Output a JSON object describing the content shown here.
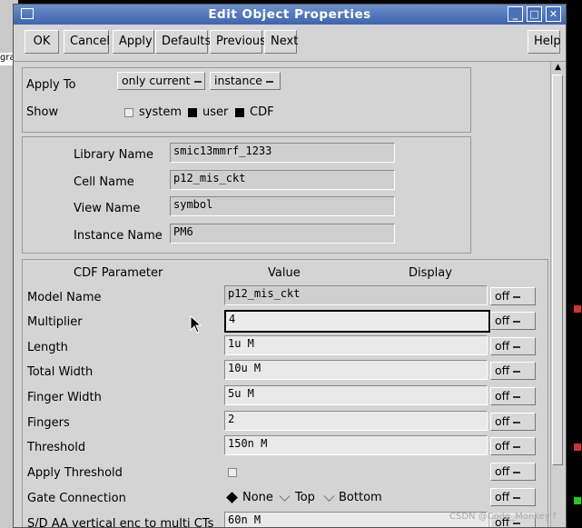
{
  "window": {
    "title": "Edit Object Properties"
  },
  "background": {
    "left_fragment": "gra",
    "watermark": "CSDN @Code_Monkey f"
  },
  "title_buttons": [
    "_",
    "□",
    "✕"
  ],
  "toolbar": {
    "ok": "OK",
    "cancel": "Cancel",
    "apply": "Apply",
    "defaults": "Defaults",
    "previous": "Previous",
    "next": "Next",
    "help": "Help"
  },
  "apply_to": {
    "label": "Apply To",
    "scope": "only current",
    "target": "instance",
    "show_label": "Show",
    "show_options": [
      {
        "label": "system",
        "checked": false
      },
      {
        "label": "user",
        "checked": true
      },
      {
        "label": "CDF",
        "checked": true
      }
    ]
  },
  "identity": {
    "library_label": "Library Name",
    "library": "smic13mmrf_1233",
    "cell_label": "Cell Name",
    "cell": "p12_mis_ckt",
    "view_label": "View Name",
    "view": "symbol",
    "instance_label": "Instance Name",
    "instance": "PM6"
  },
  "cdf": {
    "headers": {
      "param": "CDF Parameter",
      "value": "Value",
      "display": "Display"
    },
    "rows": [
      {
        "label": "Model Name",
        "value": "p12_mis_ckt",
        "display": "off"
      },
      {
        "label": "Multiplier",
        "value": "4",
        "display": "off"
      },
      {
        "label": "Length",
        "value": "1u M",
        "display": "off"
      },
      {
        "label": "Total Width",
        "value": "10u M",
        "display": "off"
      },
      {
        "label": "Finger Width",
        "value": "5u M",
        "display": "off"
      },
      {
        "label": "Fingers",
        "value": "2",
        "display": "off"
      },
      {
        "label": "Threshold",
        "value": "150n M",
        "display": "off"
      },
      {
        "label": "Apply Threshold",
        "value": "",
        "display": "off"
      },
      {
        "label": "Gate Connection",
        "value": "",
        "display": "off"
      },
      {
        "label": "S/D AA vertical enc to multi CTs",
        "value": "60n M",
        "display": "off"
      }
    ],
    "gate_options": [
      {
        "label": "None",
        "selected": true
      },
      {
        "label": "Top",
        "selected": false
      },
      {
        "label": "Bottom",
        "selected": false
      }
    ]
  }
}
